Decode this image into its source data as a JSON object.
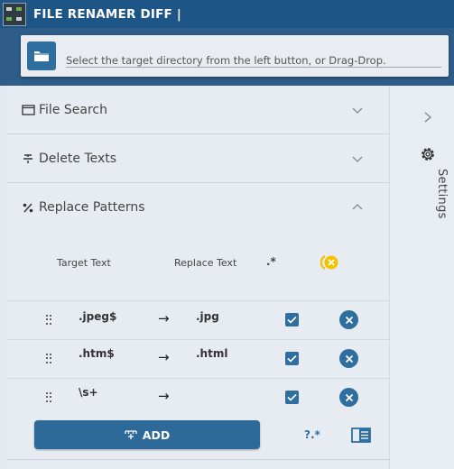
{
  "app": {
    "title": "FILE RENAMER DIFF |"
  },
  "directory": {
    "placeholder": "Select the target directory from the left button, or Drag-Drop."
  },
  "sections": {
    "file_search": {
      "label": "File Search",
      "icon": "window-icon",
      "expanded": false
    },
    "delete_texts": {
      "label": "Delete Texts",
      "icon": "strikethrough-icon",
      "expanded": false
    },
    "replace_patterns": {
      "label": "Replace Patterns",
      "icon": "percent-icon",
      "expanded": true
    }
  },
  "replace_table": {
    "columns": {
      "target": "Target Text",
      "replace": "Replace Text",
      "regex": ".*"
    },
    "rows": [
      {
        "target": ".jpeg$",
        "replace": ".jpg",
        "regex": true
      },
      {
        "target": ".htm$",
        "replace": ".html",
        "regex": true
      },
      {
        "target": "\\s+",
        "replace": "",
        "regex": true
      }
    ],
    "arrow": "→"
  },
  "actions": {
    "add_label": "ADD",
    "help_regex": "?.*"
  },
  "sidebar": {
    "settings_label": "Settings"
  },
  "colors": {
    "titlebar": "#1d5587",
    "accent": "#2f6f9f",
    "warning": "#f2c200"
  }
}
